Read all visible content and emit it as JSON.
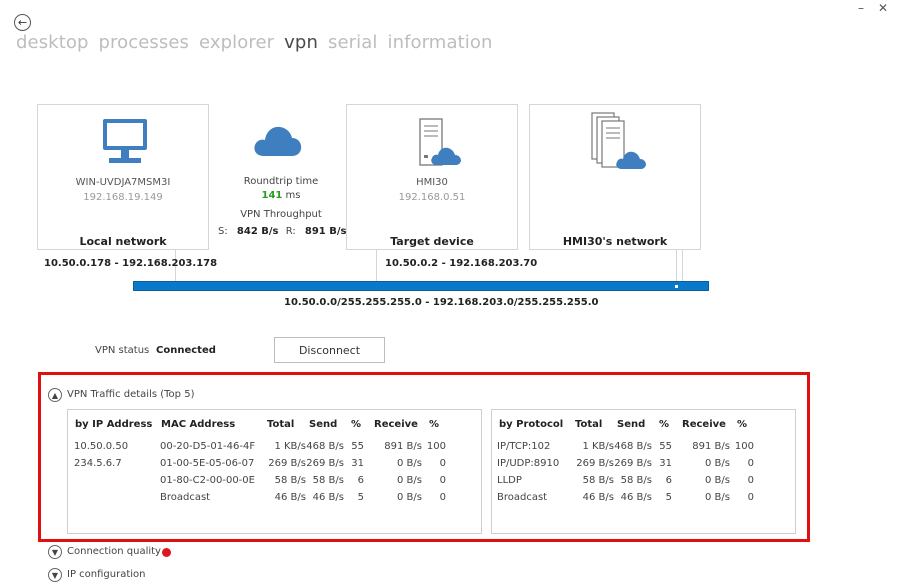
{
  "nav": {
    "items": [
      {
        "label": "desktop",
        "active": false
      },
      {
        "label": "processes",
        "active": false
      },
      {
        "label": "explorer",
        "active": false
      },
      {
        "label": "vpn",
        "active": true
      },
      {
        "label": "serial",
        "active": false
      },
      {
        "label": "information",
        "active": false
      }
    ]
  },
  "window": {
    "minimize": "–",
    "close": "✕"
  },
  "local": {
    "name": "WIN-UVDJA7MSM3I",
    "ip": "192.168.19.149",
    "label": "Local network",
    "range": "10.50.0.178 - 192.168.203.178"
  },
  "stats": {
    "roundtrip_label": "Roundtrip time",
    "roundtrip_value": "141",
    "roundtrip_unit": "ms",
    "throughput_label": "VPN Throughput",
    "send_label": "S:",
    "send_value": "842 B/s",
    "recv_label": "R:",
    "recv_value": "891 B/s"
  },
  "target": {
    "name": "HMI30",
    "ip": "192.168.0.51",
    "label": "Target device",
    "range": "10.50.0.2 - 192.168.203.70"
  },
  "remote": {
    "label": "HMI30's network"
  },
  "subnet": "10.50.0.0/255.255.255.0 - 192.168.203.0/255.255.255.0",
  "status": {
    "label": "VPN status",
    "value": "Connected",
    "button": "Disconnect"
  },
  "traffic": {
    "title": "VPN Traffic details (Top 5)",
    "by_ip": {
      "headers": [
        "by IP Address",
        "MAC Address",
        "Total",
        "Send",
        "%",
        "Receive",
        "%"
      ],
      "rows": [
        [
          "10.50.0.50",
          "00-20-D5-01-46-4F",
          "1 KB/s",
          "468 B/s",
          "55",
          "891 B/s",
          "100"
        ],
        [
          "234.5.6.7",
          "01-00-5E-05-06-07",
          "269 B/s",
          "269 B/s",
          "31",
          "0 B/s",
          "0"
        ],
        [
          "",
          "01-80-C2-00-00-0E",
          "58 B/s",
          "58 B/s",
          "6",
          "0 B/s",
          "0"
        ],
        [
          "",
          "Broadcast",
          "46 B/s",
          "46 B/s",
          "5",
          "0 B/s",
          "0"
        ]
      ]
    },
    "by_protocol": {
      "headers": [
        "by Protocol",
        "Total",
        "Send",
        "%",
        "Receive",
        "%"
      ],
      "rows": [
        [
          "IP/TCP:102",
          "1 KB/s",
          "468 B/s",
          "55",
          "891 B/s",
          "100"
        ],
        [
          "IP/UDP:8910",
          "269 B/s",
          "269 B/s",
          "31",
          "0 B/s",
          "0"
        ],
        [
          "LLDP",
          "58 B/s",
          "58 B/s",
          "6",
          "0 B/s",
          "0"
        ],
        [
          "Broadcast",
          "46 B/s",
          "46 B/s",
          "5",
          "0 B/s",
          "0"
        ]
      ]
    }
  },
  "sections": {
    "connection_quality": "Connection quality",
    "ip_configuration": "IP configuration"
  },
  "colors": {
    "accent": "#0a78c9",
    "highlight": "#e01010",
    "status_red": "#e0161e",
    "roundtrip_green": "#2a9d1f",
    "icon_blue": "#3f7fc0"
  }
}
